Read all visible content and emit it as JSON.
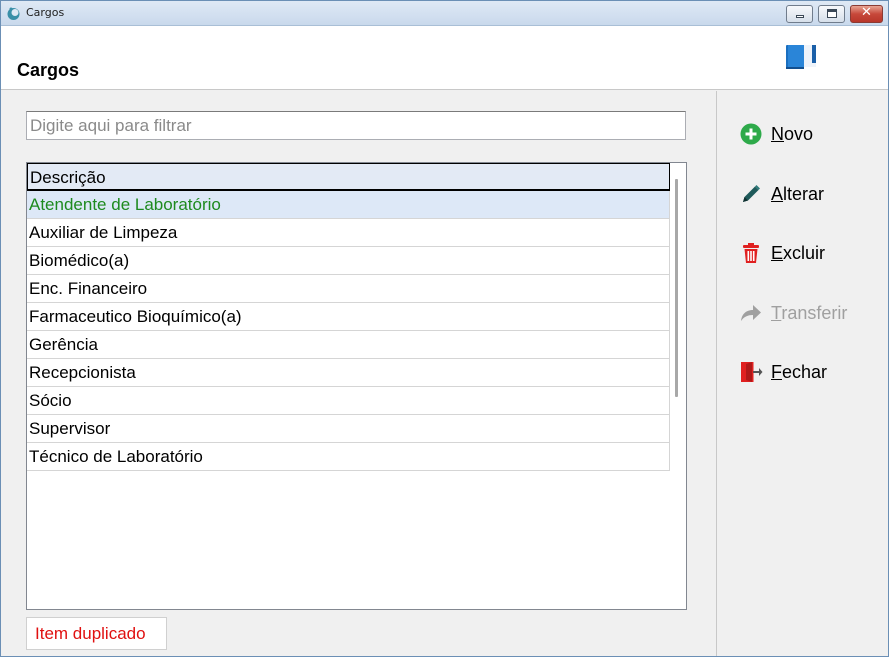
{
  "window": {
    "title": "Cargos"
  },
  "header": {
    "title": "Cargos",
    "icon": "book-icon"
  },
  "filter": {
    "placeholder": "Digite aqui para filtrar",
    "value": ""
  },
  "grid": {
    "column_header": "Descrição",
    "rows": [
      "Atendente de Laboratório",
      "Auxiliar de Limpeza",
      "Biomédico(a)",
      "Enc. Financeiro",
      "Farmaceutico Bioquímico(a)",
      "Gerência",
      "Recepcionista",
      "Sócio",
      "Supervisor",
      "Técnico de Laboratório"
    ],
    "selected_index": 0
  },
  "status": {
    "text": "Item duplicado",
    "color": "#e01010"
  },
  "actions": {
    "novo": {
      "first": "N",
      "rest": "ovo",
      "icon": "plus-circle-icon",
      "color": "#2eaa4a"
    },
    "alterar": {
      "first": "A",
      "rest": "lterar",
      "icon": "pencil-icon",
      "color": "#1f5a5a"
    },
    "excluir": {
      "first": "E",
      "rest": "xcluir",
      "icon": "trash-icon",
      "color": "#e02020"
    },
    "transferir": {
      "first": "T",
      "rest": "ransferir",
      "icon": "share-arrow-icon",
      "color": "#a0a0a0",
      "enabled": false
    },
    "fechar": {
      "first": "F",
      "rest": "echar",
      "icon": "exit-door-icon",
      "color": "#e02020"
    }
  },
  "colors": {
    "selected_row_bg": "#dde8f7",
    "selected_row_text": "#1e8a1e",
    "header_bg": "#e3eaf5"
  }
}
